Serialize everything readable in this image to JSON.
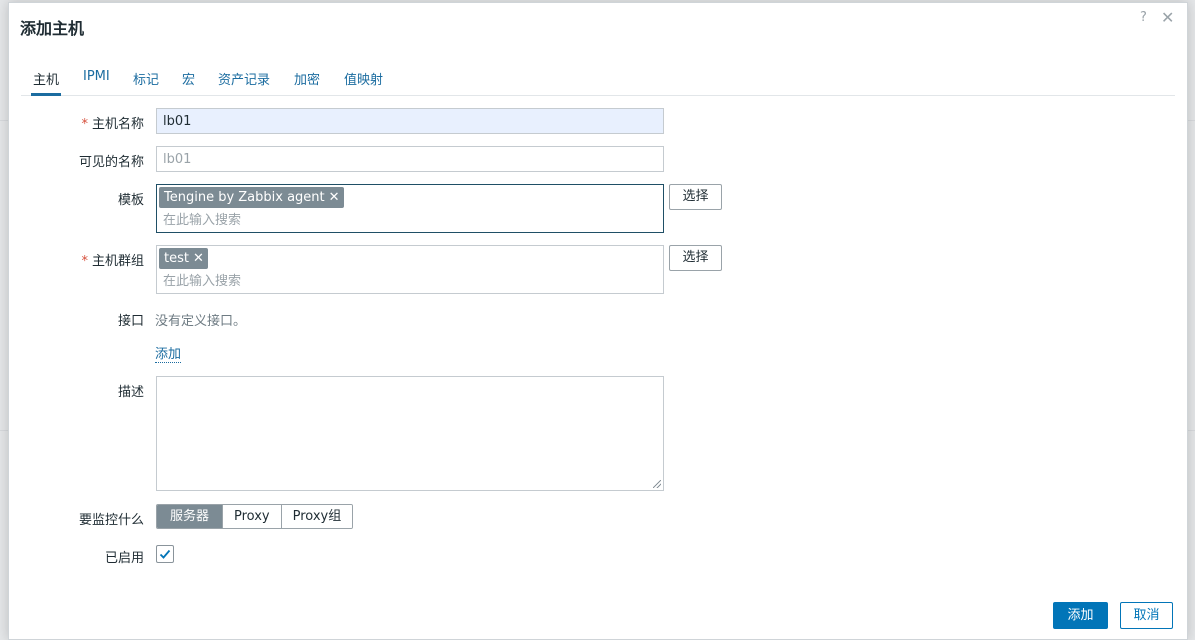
{
  "dialog": {
    "title": "添加主机",
    "help_glyph": "?",
    "close_glyph": "✕"
  },
  "tabs": [
    {
      "label": "主机",
      "active": true
    },
    {
      "label": "IPMI"
    },
    {
      "label": "标记"
    },
    {
      "label": "宏"
    },
    {
      "label": "资产记录"
    },
    {
      "label": "加密"
    },
    {
      "label": "值映射"
    }
  ],
  "form": {
    "required_mark": "*",
    "hostname": {
      "label": "主机名称",
      "value": "lb01"
    },
    "visible_name": {
      "label": "可见的名称",
      "placeholder": "lb01"
    },
    "templates": {
      "label": "模板",
      "chips": [
        "Tengine by Zabbix agent"
      ],
      "search_placeholder": "在此输入搜索",
      "select_label": "选择"
    },
    "host_groups": {
      "label": "主机群组",
      "chips": [
        "test"
      ],
      "search_placeholder": "在此输入搜索",
      "select_label": "选择"
    },
    "interfaces": {
      "label": "接口",
      "empty_text": "没有定义接口。",
      "add_label": "添加"
    },
    "description": {
      "label": "描述"
    },
    "monitored_by": {
      "label": "要监控什么",
      "options": [
        "服务器",
        "Proxy",
        "Proxy组"
      ],
      "selected": "服务器"
    },
    "enabled": {
      "label": "已启用",
      "checked": true
    }
  },
  "footer": {
    "add_label": "添加",
    "cancel_label": "取消"
  },
  "colors": {
    "primary": "#0275b8",
    "chip": "#7c8b94",
    "link": "#1b6ca0"
  },
  "chip_remove_glyph": "✕"
}
